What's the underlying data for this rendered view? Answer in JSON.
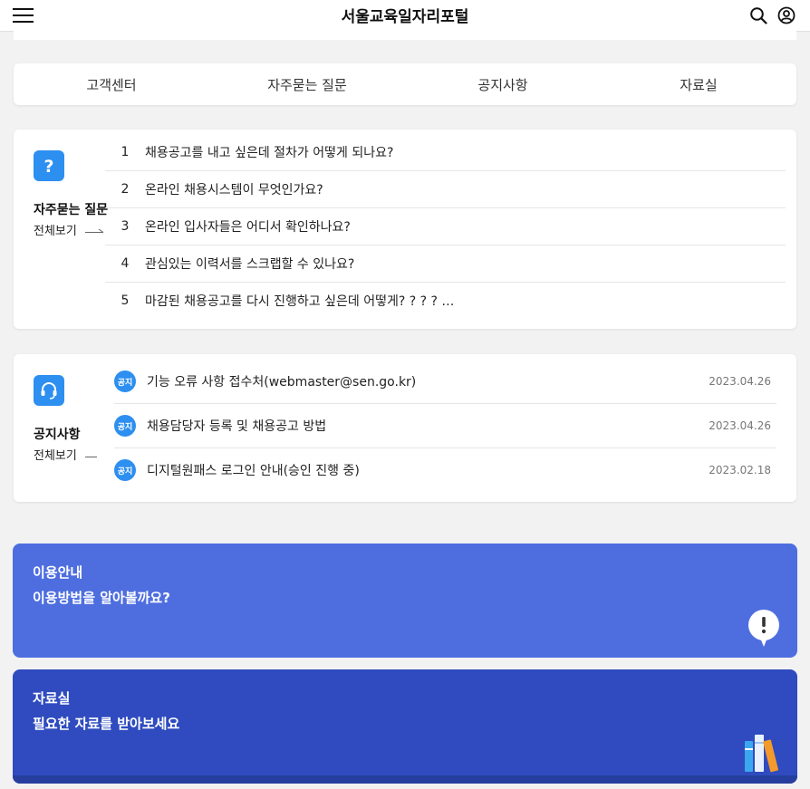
{
  "header": {
    "title": "서울교육일자리포털",
    "menu_icon": "hamburger-menu-icon",
    "search_icon": "search-icon",
    "user_icon": "user-account-icon"
  },
  "tabs": [
    {
      "label": "고객센터"
    },
    {
      "label": "자주묻는 질문"
    },
    {
      "label": "공지사항"
    },
    {
      "label": "자료실"
    }
  ],
  "faq": {
    "title": "자주묻는 질문",
    "view_all": "전체보기",
    "icon": "question-mark-icon",
    "items": [
      {
        "num": "1",
        "text": "채용공고를 내고 싶은데 절차가 어떻게 되나요?"
      },
      {
        "num": "2",
        "text": "온라인 채용시스템이 무엇인가요?"
      },
      {
        "num": "3",
        "text": "온라인 입사자들은 어디서 확인하나요?"
      },
      {
        "num": "4",
        "text": "관심있는 이력서를 스크랩할 수 있나요?"
      },
      {
        "num": "5",
        "text": "마감된 채용공고를 다시 진행하고 싶은데 어떻게? ? ? ? …"
      }
    ]
  },
  "notice": {
    "title": "공지사항",
    "view_all": "전체보기",
    "icon": "headset-icon",
    "badge": "공지",
    "items": [
      {
        "text": "기능 오류 사항 접수처(webmaster@sen.go.kr)",
        "date": "2023.04.26"
      },
      {
        "text": "채용담당자 등록 및 채용공고 방법",
        "date": "2023.04.26"
      },
      {
        "text": "디지털원패스 로그인 안내(승인 진행 중)",
        "date": "2023.02.18"
      }
    ]
  },
  "banners": {
    "guide": {
      "title": "이용안내",
      "subtitle": "이용방법을 알아볼까요?",
      "icon": "exclamation-bubble-icon",
      "color": "#4e6ee0"
    },
    "data": {
      "title": "자료실",
      "subtitle": "필요한 자료를 받아보세요",
      "icon": "books-icon",
      "color": "#2f4bbf"
    }
  },
  "colors": {
    "accent": "#2d8ff0",
    "background": "#f2f2f2"
  }
}
